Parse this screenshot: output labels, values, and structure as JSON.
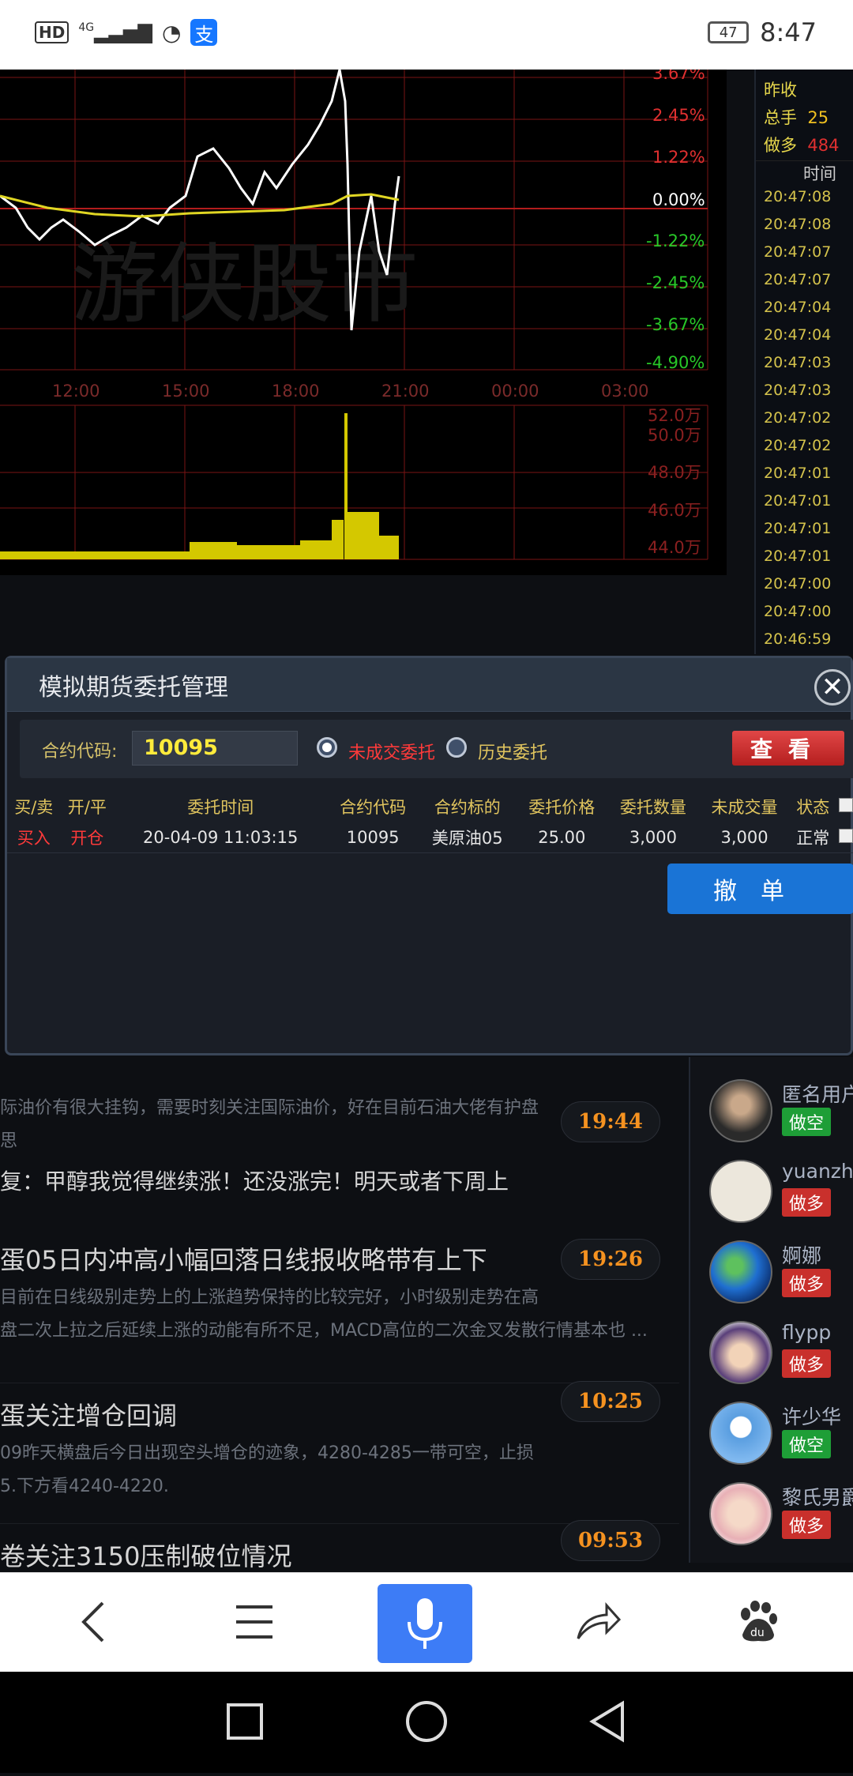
{
  "status_bar": {
    "hd": "HD",
    "net": "4G",
    "alipay": "支",
    "battery": "47",
    "time": "8:47"
  },
  "chart": {
    "watermark": "游侠股市",
    "pct_ticks": [
      "3.67%",
      "2.45%",
      "1.22%",
      "0.00%",
      "-1.22%",
      "-2.45%",
      "-3.67%",
      "-4.90%"
    ],
    "time_ticks": [
      "12:00",
      "15:00",
      "18:00",
      "21:00",
      "00:00",
      "03:00"
    ],
    "vol_ticks": [
      "52.0万",
      "50.0万",
      "48.0万",
      "46.0万",
      "44.0万"
    ]
  },
  "side_panel": {
    "row1_label": "昨收",
    "row2_label": "总手",
    "row2_value": "25",
    "row3_label": "做多",
    "row3_value": "484",
    "time_header": "时间",
    "times": [
      "20:47:08",
      "20:47:08",
      "20:47:07",
      "20:47:07",
      "20:47:04",
      "20:47:04",
      "20:47:03",
      "20:47:03",
      "20:47:02",
      "20:47:02",
      "20:47:01",
      "20:47:01",
      "20:47:01",
      "20:47:01",
      "20:47:00",
      "20:47:00",
      "20:46:59"
    ]
  },
  "dialog": {
    "title": "模拟期货委托管理",
    "close": "✕",
    "code_label": "合约代码:",
    "code_value": "10095",
    "radio1": "未成交委托",
    "radio2": "历史委托",
    "view_button": "查看",
    "columns": [
      "买/卖",
      "开/平",
      "委托时间",
      "合约代码",
      "合约标的",
      "委托价格",
      "委托数量",
      "未成交量",
      "状态"
    ],
    "row": {
      "side": "买入",
      "open_close": "开仓",
      "time": "20-04-09 11:03:15",
      "code": "10095",
      "target": "美原油05",
      "price": "25.00",
      "qty": "3,000",
      "unfilled": "3,000",
      "status": "正常"
    },
    "cancel_button": "撤单"
  },
  "news": [
    {
      "desc": "际油价有很大挂钩，需要时刻关注国际油价，好在目前石油大佬有护盘",
      "desc2": "思",
      "title": "复：甲醇我觉得继续涨！还没涨完！明天或者下周上",
      "time": "19:44"
    },
    {
      "title": "蛋05日内冲高小幅回落日线报收略带有上下",
      "desc": "目前在日线级别走势上的上涨趋势保持的比较完好，小时级别走势在高",
      "desc2": "盘二次上拉之后延续上涨的动能有所不足，MACD高位的二次金叉发散行情基本也 ...",
      "time": "19:26"
    },
    {
      "title": "蛋关注增仓回调",
      "desc": "09昨天横盘后今日出现空头增仓的迹象，4280-4285一带可空，止损",
      "desc2": "5.下方看4240-4220.",
      "time": "10:25"
    },
    {
      "title": "卷关注3150压制破位情况",
      "time": "09:53"
    }
  ],
  "users": [
    {
      "name": "匿名用户",
      "tag": "做空"
    },
    {
      "name": "yuanzhe",
      "tag": "做多"
    },
    {
      "name": "婀娜",
      "tag": "做多"
    },
    {
      "name": "flypp",
      "tag": "做多"
    },
    {
      "name": "许少华",
      "tag": "做空"
    },
    {
      "name": "黎氏男爵",
      "tag": "做多"
    }
  ],
  "colors": {
    "accent_blue": "#1a74d6",
    "short_green": "#1e9e37",
    "long_red": "#c9302c",
    "time_orange": "#f59220"
  }
}
